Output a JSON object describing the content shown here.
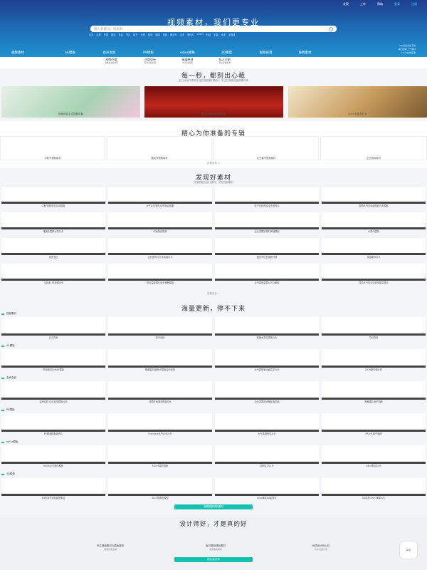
{
  "topnav": {
    "items": [
      "发现",
      "上传",
      "帮助",
      "登录",
      "注册"
    ]
  },
  "hero": {
    "slogan": "视频素材，我们更专业",
    "search_placeholder": "输入关键词，找视频",
    "hotwords": [
      "片头",
      "片尾",
      "开场",
      "婚礼",
      "年会",
      "节日",
      "粒子",
      "光效",
      "转场",
      "新闻",
      "党政",
      "倒计时",
      "企业",
      "宣传片",
      "LOGO",
      "科技",
      "字幕",
      "水墨",
      "中国风"
    ],
    "side_note": [
      "VIP会员全站下载",
      "每日更新上千素材",
      "7×24在线客服"
    ]
  },
  "categories": [
    "视频素材",
    "AE模板",
    "会声会影",
    "PR模板",
    "edius模板",
    "3D模型",
    "视频背景",
    "免费素材"
  ],
  "subnav": [
    {
      "t": "视频下载",
      "d": "海量素材免费下"
    },
    {
      "t": "正版设计",
      "d": "原创授权商用"
    },
    {
      "t": "高清原创",
      "d": "4K高清画质"
    },
    {
      "t": "私人订制",
      "d": "专业定制服务"
    }
  ],
  "sec1": {
    "title": "每一秒，都别出心裁",
    "sub": "全力为用户提供专业的视频素材服务，专注打造精品视频素材库",
    "banners": [
      "唯美荷花中式视频背景",
      "喜迎国庆红色党政模板",
      "2019年春节片头"
    ]
  },
  "sec2": {
    "title": "精心为你准备的专辑",
    "cards": [
      "中秋节视频素材",
      "国庆节视频素材",
      "元旦春节视频素材",
      "企业宣传素材"
    ],
    "more": "查看更多 >"
  },
  "sec3": {
    "title": "发现好素材",
    "sub": "好用精致的设计素材，尽在视频素材",
    "items": [
      "中秋节圆月月亮AE模板",
      "大气企业宣传片开场AE模板",
      "粒子光线科技企业宣传片",
      "震撼大气史诗级电影片头模板",
      "唯美中国风水墨片头",
      "时尚快闪视频",
      "企业发展历程时间轴模板",
      "水墨中国风",
      "欢庆节日",
      "企业宣传片文字动画片头",
      "国庆节红色党政开场",
      "喜迎春节片头",
      "【原创】科技感片头",
      "简约温馨婚礼电子相册模板",
      "大气震撼金属LOGO演绎",
      "简洁大气的企业宣传图文展示"
    ],
    "more": "查看更多 >"
  },
  "sec4": {
    "title": "海量更新，停不下来",
    "groups": [
      {
        "name": "视频素材",
        "items": [
          "LED背景",
          "粒子光线",
          "唯美水墨中国风片头",
          "节日背景"
        ]
      },
      {
        "name": "AE模板",
        "items": [
          "时尚快闪片头AE模板",
          "唯美婚礼相册AE模板企业宣传",
          "大气震撼史诗级文字片头",
          "2019新年倒计时"
        ]
      },
      {
        "name": "会声会影",
        "items": [
          "会声会影 企业宣传模板片头",
          "动感时尚潮流视频片头",
          "企业发展时间轴年度总结",
          "唯美婚礼电子相册"
        ]
      },
      {
        "name": "PR模板",
        "items": [
          "PR视频模板宣传片",
          "Premiere大气企业片头",
          "大气震撼快闪片头",
          "PR片头电子相册"
        ]
      },
      {
        "name": "edius模板",
        "items": [
          "edius企业宣传模板",
          "EDIUS婚礼相册",
          "快闪文字片头",
          "edius科技片头"
        ]
      },
      {
        "name": "3D模型",
        "items": [
          "3D室内外场景模型集合",
          "3D人物角色模型",
          "logo演绎3D金属字",
          "3D动态LOGO演绎片头"
        ]
      }
    ],
    "button": "查看更多精彩素材"
  },
  "footer": {
    "title": "设计师好，才是真的好",
    "cols": [
      {
        "a": "专注视频素材与模板服务",
        "b": "海量优质资源"
      },
      {
        "a": "每日更新精品素材",
        "b": "满足各类需求"
      },
      {
        "a": "优质设计师入驻",
        "b": "共享创意价值"
      }
    ],
    "badge": "客服",
    "button": "成为设计师"
  }
}
